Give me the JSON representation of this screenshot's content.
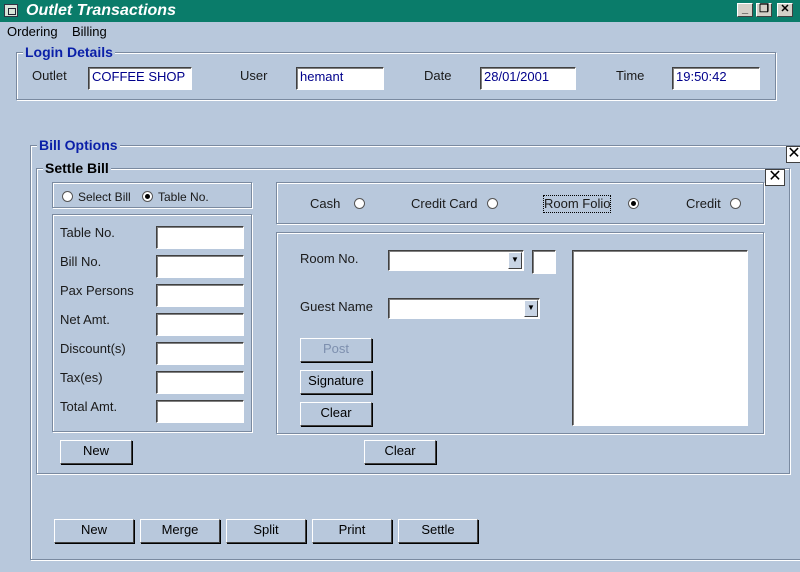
{
  "window": {
    "title": "Outlet Transactions",
    "controls": {
      "minimize": "_",
      "restore": "❐",
      "close": "✕"
    }
  },
  "menu": {
    "items": [
      "Ordering",
      "Billing"
    ]
  },
  "login": {
    "legend": "Login Details",
    "outlet_label": "Outlet",
    "outlet_value": "COFFEE SHOP",
    "user_label": "User",
    "user_value": "hemant",
    "date_label": "Date",
    "date_value": "28/01/2001",
    "time_label": "Time",
    "time_value": "19:50:42"
  },
  "bill_options": {
    "legend": "Bill Options",
    "close_glyph": "✕"
  },
  "settle": {
    "legend": "Settle Bill",
    "close_glyph": "✕",
    "select_bill_label": "Select Bill",
    "table_no_option_label": "Table No.",
    "selected_mode": "Table No.",
    "fields": [
      {
        "label": "Table No.",
        "value": ""
      },
      {
        "label": "Bill No.",
        "value": ""
      },
      {
        "label": "Pax Persons",
        "value": ""
      },
      {
        "label": "Net Amt.",
        "value": ""
      },
      {
        "label": "Discount(s)",
        "value": ""
      },
      {
        "label": "Tax(es)",
        "value": ""
      },
      {
        "label": "Total Amt.",
        "value": ""
      }
    ],
    "payment_modes": [
      "Cash",
      "Credit Card",
      "Room Folio",
      "Credit"
    ],
    "selected_payment": "Room Folio",
    "room_no_label": "Room No.",
    "room_no_value": "",
    "guest_name_label": "Guest Name",
    "guest_name_value": "",
    "post_label": "Post",
    "signature_label": "Signature",
    "inner_clear_label": "Clear",
    "new_label": "New",
    "clear_label": "Clear"
  },
  "actions": [
    "New",
    "Merge",
    "Split",
    "Print",
    "Settle"
  ],
  "colors": {
    "title_bar": "#0a7c6a",
    "background": "#b8c8dc",
    "legend_blue": "#0a1fa8",
    "field_text": "#00008b"
  }
}
